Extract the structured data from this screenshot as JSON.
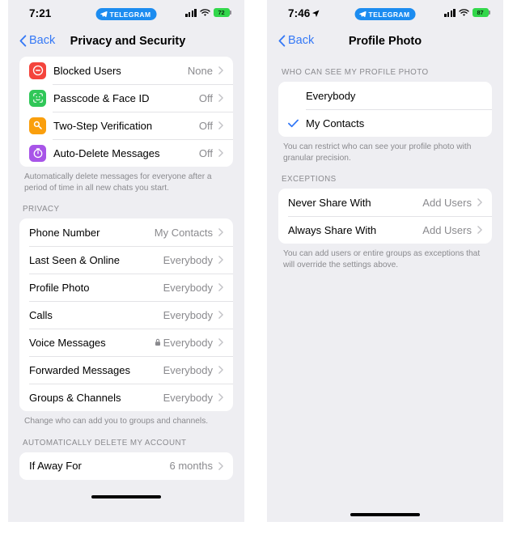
{
  "screens": [
    {
      "id": "privacy-and-security",
      "status": {
        "time": "7:21",
        "location_arrow": false,
        "carrier_pill": "TELEGRAM",
        "battery": "72",
        "battery_charging": true,
        "signal_bars": 4,
        "wifi": true
      },
      "nav": {
        "back": "Back",
        "title": "Privacy and Security"
      },
      "sections": [
        {
          "header": "",
          "rows": [
            {
              "icon": "block-icon",
              "icon_color": "#f4443c",
              "label": "Blocked Users",
              "value": "None",
              "chevron": true
            },
            {
              "icon": "face-id-icon",
              "icon_color": "#30c758",
              "label": "Passcode & Face ID",
              "value": "Off",
              "chevron": true
            },
            {
              "icon": "key-icon",
              "icon_color": "#fa9f0d",
              "label": "Two-Step Verification",
              "value": "Off",
              "chevron": true
            },
            {
              "icon": "timer-icon",
              "icon_color": "#a855e8",
              "label": "Auto-Delete Messages",
              "value": "Off",
              "chevron": true
            }
          ],
          "footer": "Automatically delete messages for everyone after a period of time in all new chats you start."
        },
        {
          "header": "PRIVACY",
          "rows": [
            {
              "label": "Phone Number",
              "value": "My Contacts",
              "chevron": true
            },
            {
              "label": "Last Seen & Online",
              "value": "Everybody",
              "chevron": true
            },
            {
              "label": "Profile Photo",
              "value": "Everybody",
              "chevron": true
            },
            {
              "label": "Calls",
              "value": "Everybody",
              "chevron": true
            },
            {
              "label": "Voice Messages",
              "value": "Everybody",
              "lock": true,
              "chevron": true
            },
            {
              "label": "Forwarded Messages",
              "value": "Everybody",
              "chevron": true
            },
            {
              "label": "Groups & Channels",
              "value": "Everybody",
              "chevron": true
            }
          ],
          "footer": "Change who can add you to groups and channels."
        },
        {
          "header": "AUTOMATICALLY DELETE MY ACCOUNT",
          "rows": [
            {
              "label": "If Away For",
              "value": "6 months",
              "chevron": true
            }
          ],
          "footer": ""
        }
      ]
    },
    {
      "id": "profile-photo",
      "status": {
        "time": "7:46",
        "location_arrow": true,
        "carrier_pill": "TELEGRAM",
        "battery": "87",
        "battery_charging": true,
        "signal_bars": 4,
        "wifi": true
      },
      "nav": {
        "back": "Back",
        "title": "Profile Photo"
      },
      "sections": [
        {
          "header": "WHO CAN SEE MY PROFILE PHOTO",
          "options": [
            {
              "label": "Everybody",
              "selected": false
            },
            {
              "label": "My Contacts",
              "selected": true
            }
          ],
          "footer": "You can restrict who can see your profile photo with granular precision."
        },
        {
          "header": "EXCEPTIONS",
          "rows": [
            {
              "label": "Never Share With",
              "value": "Add Users",
              "chevron": true
            },
            {
              "label": "Always Share With",
              "value": "Add Users",
              "chevron": true
            }
          ],
          "footer": "You can add users or entire groups as exceptions that will override the settings above."
        }
      ]
    }
  ],
  "colors": {
    "accent_blue": "#3478f6",
    "telegram_blue": "#1c8cf0",
    "battery_green": "#32d74b",
    "background": "#eeeef2",
    "card": "#ffffff",
    "secondary_text": "#8a8a8e"
  }
}
